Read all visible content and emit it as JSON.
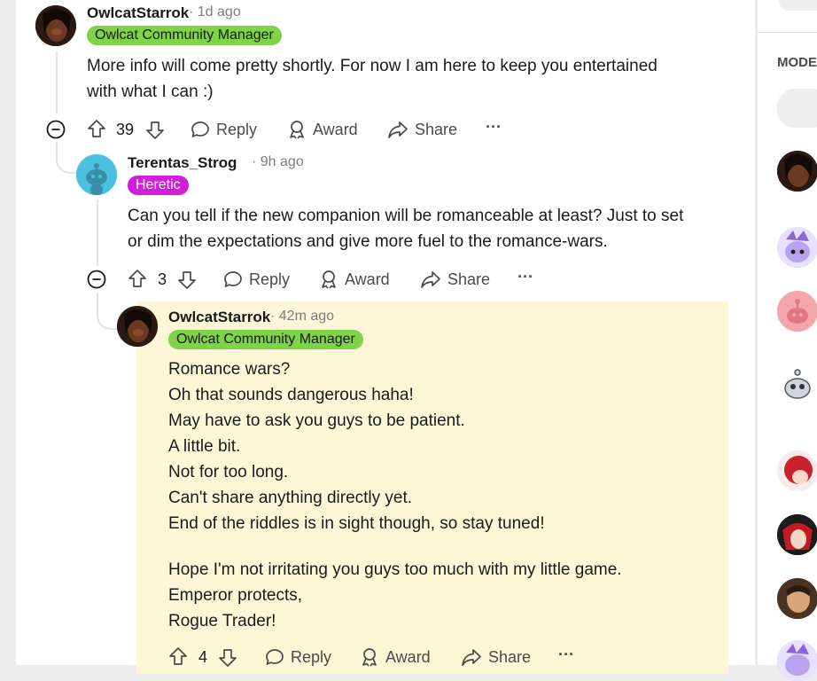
{
  "comments": [
    {
      "username": "OwlcatStarrok",
      "time": "1d ago",
      "flair": "Owlcat Community Manager",
      "body": [
        "More info will come pretty shortly. For now I am here to keep you entertained",
        "with what I can :)"
      ],
      "votes": "39"
    },
    {
      "username": "Terentas_Strog",
      "time": "9h ago",
      "flair": "Heretic",
      "body": [
        "Can you tell if the new companion will be romanceable at least? Just to set",
        "or dim the expectations and give more fuel to the romance-wars."
      ],
      "votes": "3"
    },
    {
      "username": "OwlcatStarrok",
      "time": "42m ago",
      "flair": "Owlcat Community Manager",
      "body": [
        "Romance wars?",
        "Oh that sounds dangerous haha!",
        "May have to ask you guys to be patient.",
        "A little bit.",
        "Not for too long.",
        "Can't share anything directly yet.",
        "End of the riddles is in sight though, so stay tuned!",
        "",
        "Hope I'm not irritating you guys too much with my little game.",
        "Emperor protects,",
        "Rogue Trader!"
      ],
      "votes": "4"
    }
  ],
  "actions": {
    "reply": "Reply",
    "award": "Award",
    "share": "Share",
    "more": "···",
    "separator": "·"
  },
  "sidebar": {
    "label": "MODE"
  },
  "colors": {
    "community_manager_flair": "#7ed348",
    "heretic_flair": "#d21dd9",
    "highlight": "#fdf7d7"
  }
}
